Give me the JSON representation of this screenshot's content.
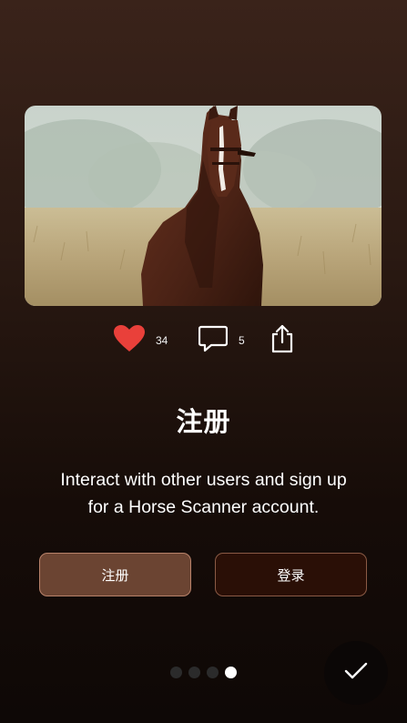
{
  "hero": {
    "image_icon": "horse-photo"
  },
  "actions": {
    "like_icon": "heart-icon",
    "like_count": "34",
    "comment_icon": "comment-icon",
    "comment_count": "5",
    "share_icon": "share-icon"
  },
  "onboarding": {
    "title": "注册",
    "description": "Interact with other users and sign up for a Horse Scanner account.",
    "register_label": "注册",
    "login_label": "登录",
    "page_count": 4,
    "active_page": 4
  },
  "colors": {
    "heart": "#e9403a",
    "register_bg": "#6b4432",
    "login_bg": "#2a0f06"
  }
}
